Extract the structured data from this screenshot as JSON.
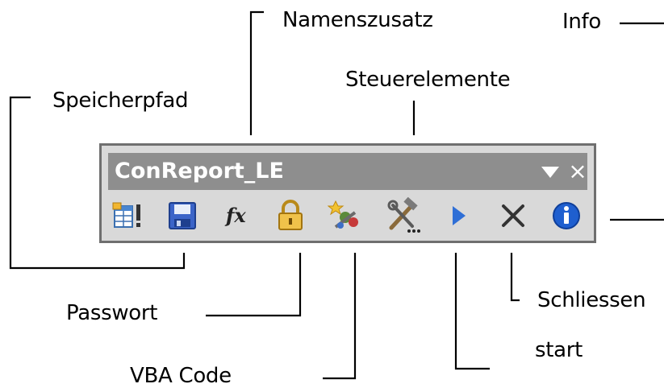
{
  "toolbar": {
    "title": "ConReport_LE",
    "menu_icon": "dropdown-triangle-icon",
    "close_glyph": "×",
    "buttons": [
      {
        "id": "namenszusatz",
        "icon": "namenszusatz-icon"
      },
      {
        "id": "speicherpfad",
        "icon": "save-disk-icon"
      },
      {
        "id": "formula",
        "icon": "fx-formula-icon"
      },
      {
        "id": "passwort",
        "icon": "padlock-icon"
      },
      {
        "id": "vba-code",
        "icon": "vba-code-icon"
      },
      {
        "id": "steuerelemente",
        "icon": "tools-hammer-wrench-icon"
      },
      {
        "id": "start",
        "icon": "play-arrow-icon"
      },
      {
        "id": "schliessen",
        "icon": "close-x-icon"
      },
      {
        "id": "info",
        "icon": "info-icon"
      }
    ]
  },
  "callouts": {
    "namenszusatz": "Namenszusatz",
    "info": "Info",
    "steuerelemente": "Steuerelemente",
    "speicherpfad": "Speicherpfad",
    "passwort": "Passwort",
    "vba_code": "VBA Code",
    "schliessen": "Schliessen",
    "start": "start"
  },
  "colors": {
    "titlebar": "#8e8e8e",
    "toolbar_bg": "#d9d9d9",
    "play_blue": "#2f6fd6",
    "info_blue": "#1f5fcf"
  }
}
